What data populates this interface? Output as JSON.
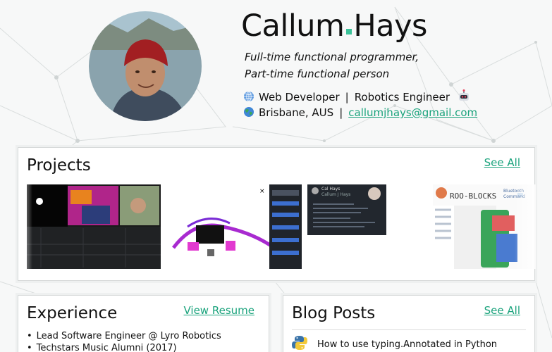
{
  "profile": {
    "first_name": "Callum",
    "last_name": "Hays",
    "tagline_1": "Full-time functional programmer,",
    "tagline_2": "Part-time functional person",
    "role_1": "Web Developer",
    "role_sep": "|",
    "role_2": "Robotics Engineer",
    "location": "Brisbane, AUS",
    "email": "callumjhays@gmail.com",
    "icons": [
      "globe-icon",
      "robot-icon",
      "earth-icon"
    ]
  },
  "projects": {
    "title": "Projects",
    "see_all": "See All",
    "thumb_4_title": "ROO-BLOCKS",
    "thumb_4_label": "Bluetooth\nCommand",
    "thumb_3_user": "Cal Hays",
    "thumb_3_sub": "Callum J Hays"
  },
  "experience": {
    "title": "Experience",
    "link": "View Resume",
    "items": [
      "Lead Software Engineer @ Lyro Robotics",
      "Techstars Music Alumni (2017)"
    ]
  },
  "blog": {
    "title": "Blog Posts",
    "see_all": "See All",
    "posts": [
      "How to use typing.Annotated in Python"
    ]
  },
  "colors": {
    "accent": "#1aa37c",
    "accent_dot": "#3cc39a"
  }
}
